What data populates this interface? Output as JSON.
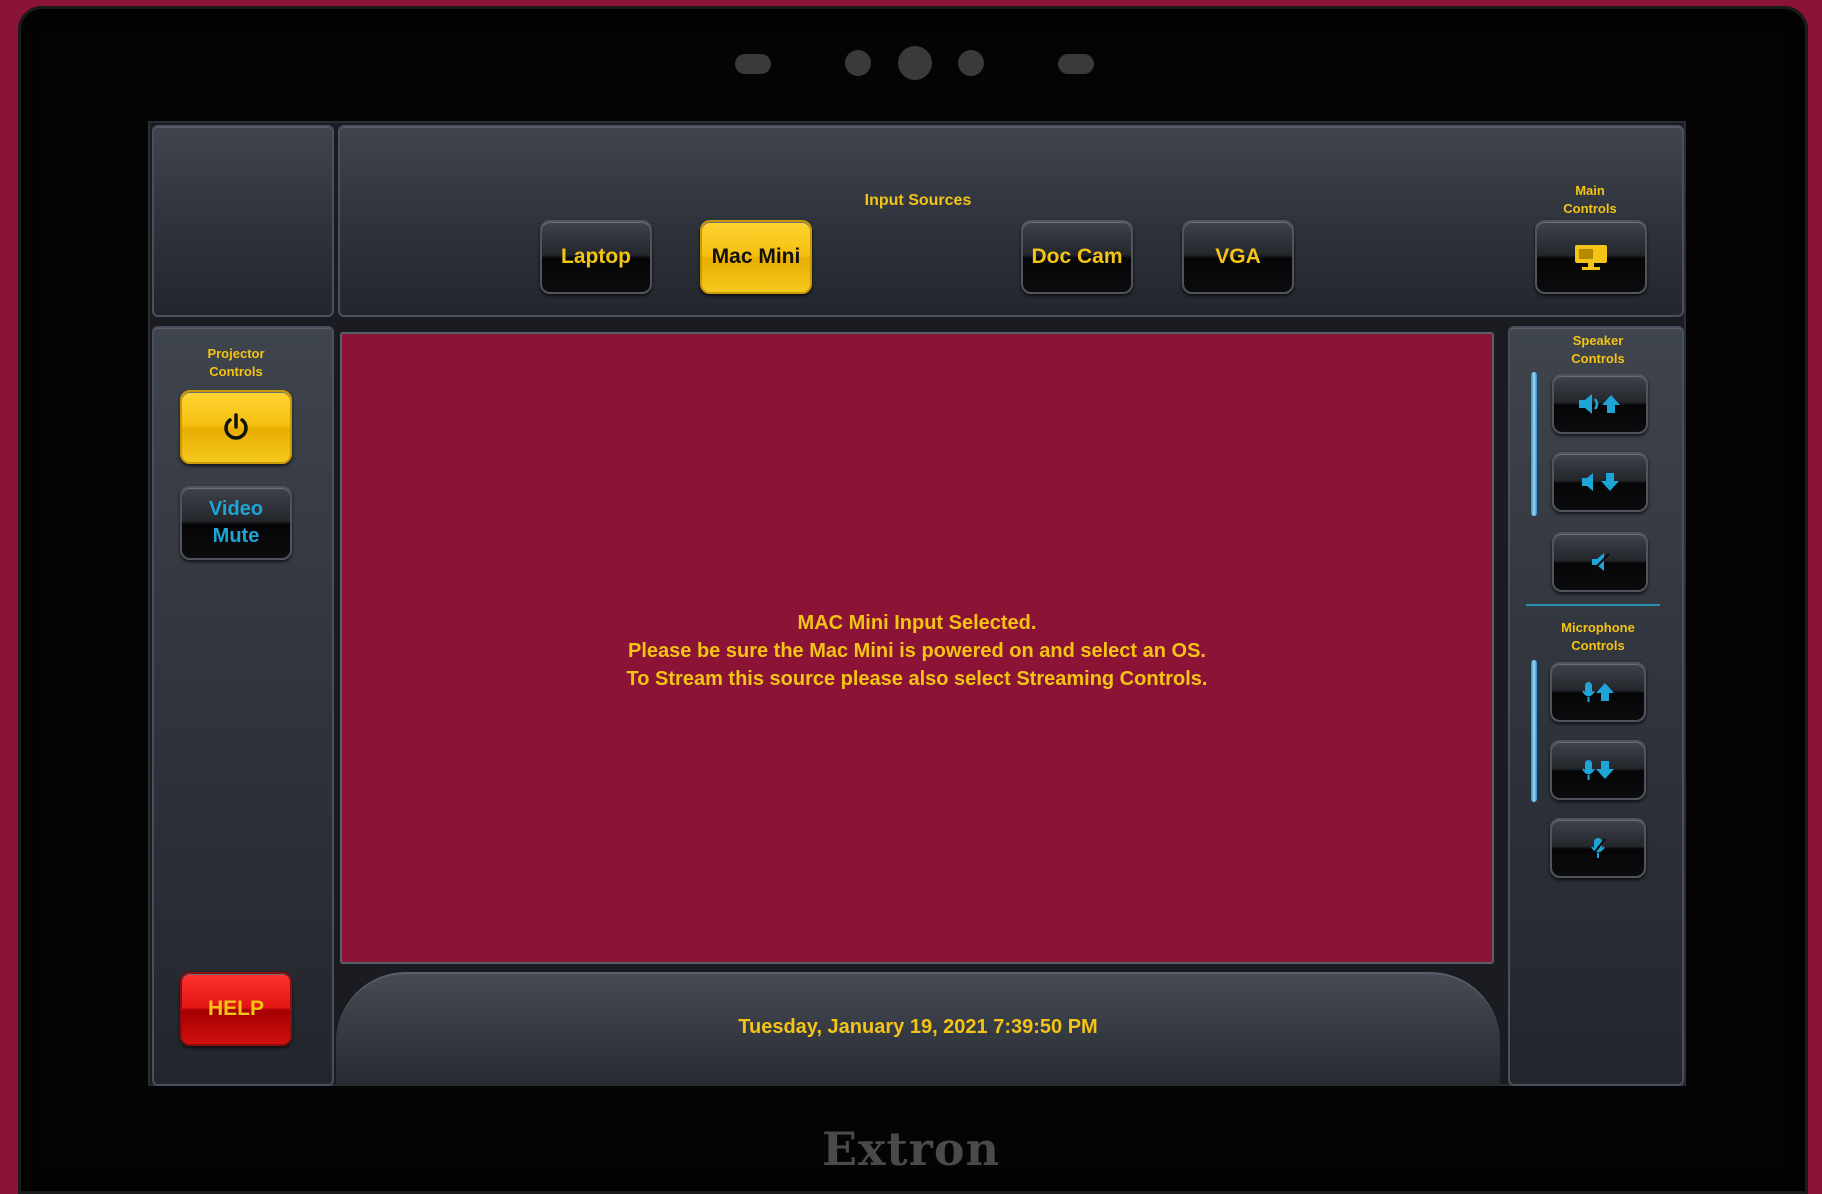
{
  "brand": "Extron",
  "colors": {
    "accent": "#f3c315",
    "background": "#8a1336",
    "blue_icon": "#1ea5d8"
  },
  "header": {
    "input_sources_label": "Input Sources",
    "main_controls_label_1": "Main",
    "main_controls_label_2": "Controls",
    "main_controls_icon": "monitor-icon",
    "sources": [
      {
        "label": "Laptop",
        "active": false
      },
      {
        "label": "Mac Mini",
        "active": true
      },
      {
        "label": "Doc Cam",
        "active": false
      },
      {
        "label": "VGA",
        "active": false
      }
    ]
  },
  "left": {
    "projector_label_1": "Projector",
    "projector_label_2": "Controls",
    "power_icon": "power-icon",
    "video_mute_1": "Video",
    "video_mute_2": "Mute",
    "help": "HELP"
  },
  "right": {
    "speaker_label_1": "Speaker",
    "speaker_label_2": "Controls",
    "speaker_buttons": [
      "volume-up-icon",
      "volume-down-icon",
      "speaker-mute-icon"
    ],
    "mic_label_1": "Microphone",
    "mic_label_2": "Controls",
    "mic_buttons": [
      "mic-up-icon",
      "mic-down-icon",
      "mic-mute-icon"
    ]
  },
  "main": {
    "line1": "MAC Mini Input Selected.",
    "line2": "Please be sure the Mac Mini is powered on and select an OS.",
    "line3": "To Stream this source please also select Streaming Controls."
  },
  "footer": {
    "datetime": "Tuesday, January 19, 2021 7:39:50 PM"
  }
}
